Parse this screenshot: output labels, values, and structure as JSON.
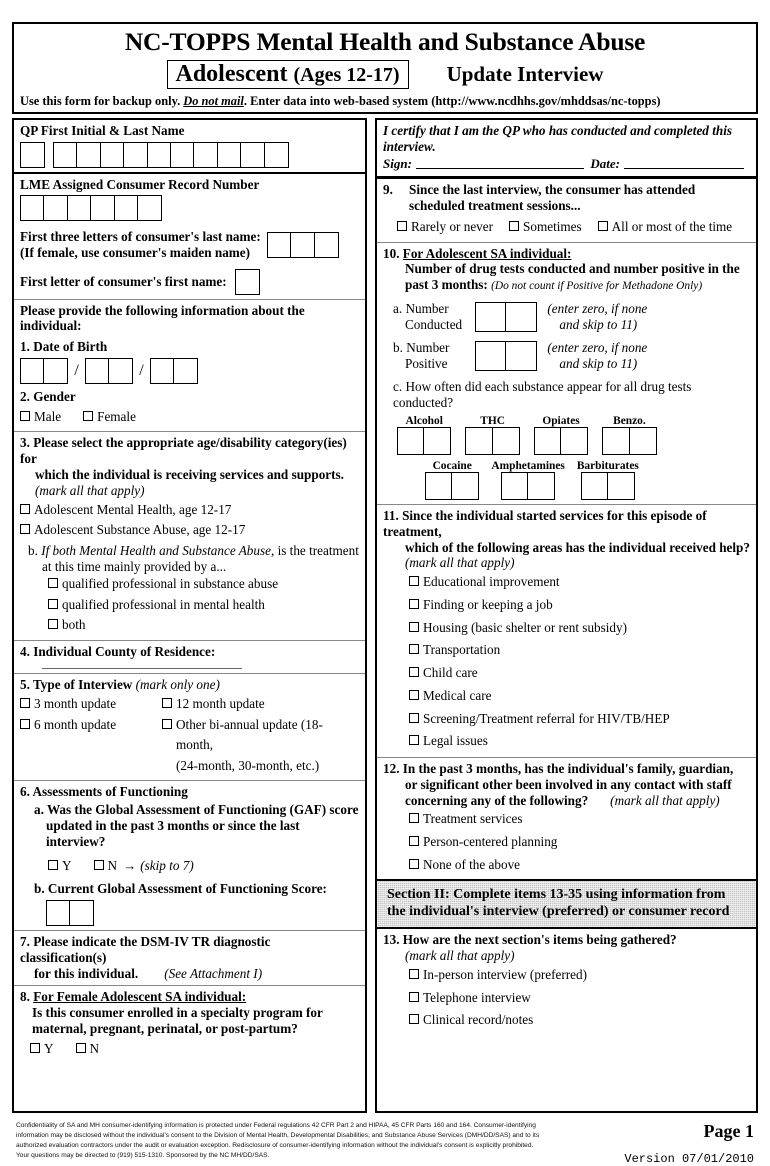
{
  "header": {
    "title_line1": "NC-TOPPS Mental Health and Substance Abuse",
    "boxed_title": "Adolescent",
    "boxed_ages": "(Ages 12-17)",
    "interview_type": "Update Interview",
    "instruction_pre": "Use this form for backup only. ",
    "instruction_em": "Do not mail",
    "instruction_post": ". Enter data into web-based system (http://www.ncdhhs.gov/mhddsas/nc-topps)"
  },
  "left": {
    "qp_name_label": "QP First Initial & Last Name",
    "qp_initial_boxes": 1,
    "qp_last_boxes": 10,
    "lme_label": "LME Assigned Consumer Record Number",
    "lme_boxes": 6,
    "last3_label_l1": "First three letters of consumer's last name:",
    "last3_label_l2": "(If female, use consumer's maiden name)",
    "last3_boxes": 3,
    "first_letter_label": "First letter of consumer's first name:",
    "first_letter_boxes": 1,
    "provide_info": "Please provide the following information about the individual:",
    "q1_label": "1. Date of Birth",
    "q2_label": "2. Gender",
    "q2_options": [
      "Male",
      "Female"
    ],
    "q3_label_l1": "3. Please select the appropriate age/disability category(ies) for",
    "q3_label_l2": "which the individual is receiving services and supports.",
    "q3_note": "(mark all that apply)",
    "q3_options": [
      "Adolescent Mental Health, age 12-17",
      "Adolescent Substance Abuse, age 12-17"
    ],
    "q3b_prefix": "b. ",
    "q3b_italic": "If both Mental Health and Substance Abuse,",
    "q3b_rest": " is the treatment",
    "q3b_l2": "at this time mainly provided by a...",
    "q3b_options": [
      "qualified professional in substance abuse",
      "qualified professional in mental health",
      "both"
    ],
    "q4_label": "4. Individual County of Residence:",
    "q5_label": "5. Type of Interview",
    "q5_note": "(mark only one)",
    "q5_options_left": [
      "3 month update",
      "6 month update"
    ],
    "q5_option_12": "12 month update",
    "q5_option_other_l1": "Other bi-annual update (18-month,",
    "q5_option_other_l2": "(24-month, 30-month, etc.)",
    "q6_label": "6. Assessments of Functioning",
    "q6a_l1": "a. Was the Global Assessment of Functioning (GAF) score",
    "q6a_l2": "updated in the past 3 months or since the last interview?",
    "q6a_y": "Y",
    "q6a_n": "N",
    "q6a_skip": "(skip to 7)",
    "q6b_label": "b. Current Global Assessment of Functioning Score:",
    "q6b_boxes": 2,
    "q7_l1": "7.  Please indicate the DSM-IV TR diagnostic classification(s)",
    "q7_l2": "for this individual.",
    "q7_note": "(See Attachment I)",
    "q8_num": "8. ",
    "q8_title": "For Female Adolescent SA individual:",
    "q8_l1": "Is this consumer enrolled in a specialty program for",
    "q8_l2": "maternal, pregnant, perinatal, or post-partum?",
    "q8_y": "Y",
    "q8_n": "N"
  },
  "right": {
    "certify_l1": "I certify that I am the QP who has conducted and completed this",
    "certify_l2": "interview.",
    "sign_label": "Sign:",
    "date_label": "Date:",
    "q9_num": "9.",
    "q9_l1": "Since the last interview, the consumer has attended",
    "q9_l2": "scheduled treatment sessions...",
    "q9_options": [
      "Rarely or never",
      "Sometimes",
      "All or most of the time"
    ],
    "q10_num": "10. ",
    "q10_title": "For Adolescent SA individual:",
    "q10_l1": "Number of drug tests conducted and number positive in the",
    "q10_l2": "past 3 months:",
    "q10_note": "(Do not count if Positive for Methadone Only)",
    "q10a_l1": "a. Number",
    "q10a_l2": "Conducted",
    "q10a_note_l1": "(enter zero, if none",
    "q10a_note_l2": "and skip to 11)",
    "q10b_l1": "b. Number",
    "q10b_l2": "Positive",
    "q10b_note_l1": "(enter zero, if none",
    "q10b_note_l2": "and skip to 11)",
    "q10c_label": "c. How often did each substance appear for all drug tests conducted?",
    "q10c_row1": [
      "Alcohol",
      "THC",
      "Opiates",
      "Benzo."
    ],
    "q10c_row2": [
      "Cocaine",
      "Amphetamines",
      "Barbiturates"
    ],
    "q11_num": "11. ",
    "q11_l1": "Since the individual started services for this episode of treatment,",
    "q11_l2": "which of the following areas has the individual received help?",
    "q11_note": "(mark all that apply)",
    "q11_options": [
      "Educational improvement",
      "Finding or keeping a job",
      "Housing (basic shelter or rent subsidy)",
      "Transportation",
      "Child care",
      "Medical care",
      "Screening/Treatment referral for HIV/TB/HEP",
      "Legal issues"
    ],
    "q12_num": "12. ",
    "q12_l1": "In the past 3 months, has the individual's family, guardian,",
    "q12_l2": "or significant other been involved in any contact with staff",
    "q12_l3": "concerning any of the following?",
    "q12_note": "(mark all that apply)",
    "q12_options": [
      "Treatment services",
      "Person-centered planning",
      "None of the above"
    ],
    "section2_l1": "Section II: Complete items 13-35 using information from",
    "section2_l2": "the individual's interview (preferred) or consumer record",
    "q13_label": "13. How are the next section's items being gathered?",
    "q13_note": "(mark all that apply)",
    "q13_options": [
      "In-person interview (preferred)",
      "Telephone interview",
      "Clinical record/notes"
    ]
  },
  "footer": {
    "confidentiality_l1": "Confidentiality of SA and MH consumer-identifying information is protected under Federal regulations 42 CFR Part 2 and HIPAA, 45 CFR Parts 160 and 164.  Consumer-identifying",
    "confidentiality_l2": "information may be disclosed without the individual's consent to the Division of Mental Health, Developmental Disabilities, and Substance Abuse Services (DMH/DD/SAS) and to its",
    "confidentiality_l3": "authorized evaluation contractors under the audit or evaluation exception.  Redisclosure of consumer-identifying  information without the individual's consent is explicitly prohibited.",
    "confidentiality_l4": "Your  questions may be directed to (919) 515-1310.  Sponsored by the NC MH/DD/SAS.",
    "page_number": "Page 1",
    "version": "Version 07/01/2010"
  }
}
